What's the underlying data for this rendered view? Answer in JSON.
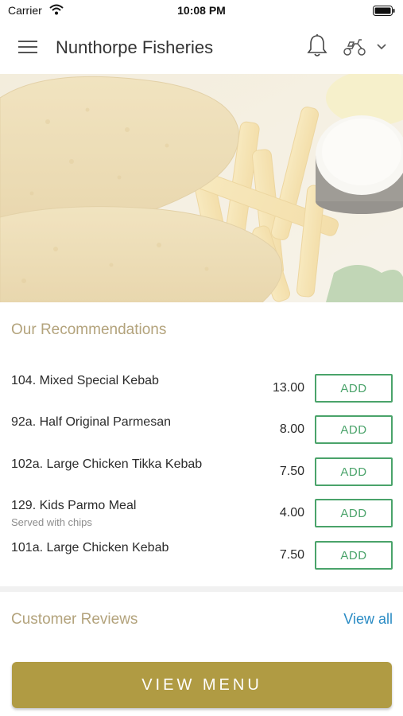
{
  "status_bar": {
    "carrier": "Carrier",
    "time": "10:08 PM"
  },
  "header": {
    "title": "Nunthorpe Fisheries",
    "icons": [
      "menu-icon",
      "bell-icon",
      "scooter-icon",
      "chevron-down-icon"
    ]
  },
  "recommendations": {
    "title": "Our Recommendations",
    "add_label": "ADD",
    "items": [
      {
        "name": "104. Mixed Special Kebab",
        "subtitle": "",
        "price": "13.00"
      },
      {
        "name": "92a. Half Original Parmesan",
        "subtitle": "",
        "price": "8.00"
      },
      {
        "name": "102a. Large Chicken Tikka Kebab",
        "subtitle": "",
        "price": "7.50"
      },
      {
        "name": "129. Kids Parmo Meal",
        "subtitle": "Served with chips",
        "price": "4.00"
      },
      {
        "name": "101a. Large Chicken Kebab",
        "subtitle": "",
        "price": "7.50"
      }
    ]
  },
  "reviews": {
    "title": "Customer Reviews",
    "view_all": "View all"
  },
  "footer": {
    "view_menu": "VIEW MENU"
  },
  "colors": {
    "accent_gold": "#b09b43",
    "section_title": "#b3a37c",
    "add_green": "#4aa36a",
    "link_blue": "#2a8bc4"
  }
}
